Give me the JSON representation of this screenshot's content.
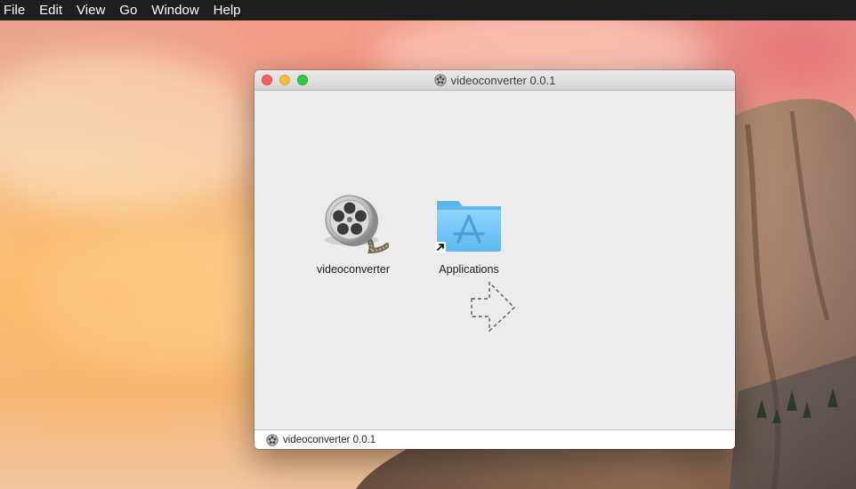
{
  "menubar": {
    "items": [
      "File",
      "Edit",
      "View",
      "Go",
      "Window",
      "Help"
    ]
  },
  "window": {
    "title": "videoconverter 0.0.1",
    "items": [
      {
        "label": "videoconverter",
        "icon": "film-reel-icon"
      },
      {
        "label": "Applications",
        "icon": "applications-folder-icon"
      }
    ],
    "statusbar": {
      "path_label": "videoconverter 0.0.1",
      "icon": "film-reel-icon"
    }
  },
  "colors": {
    "menubar_bg": "#1e1e1e",
    "window_bg": "#ececec",
    "folder_blue": "#6cc3f5",
    "traffic_close": "#fc605c",
    "traffic_minimize": "#fdbc40",
    "traffic_zoom": "#34c84a"
  }
}
